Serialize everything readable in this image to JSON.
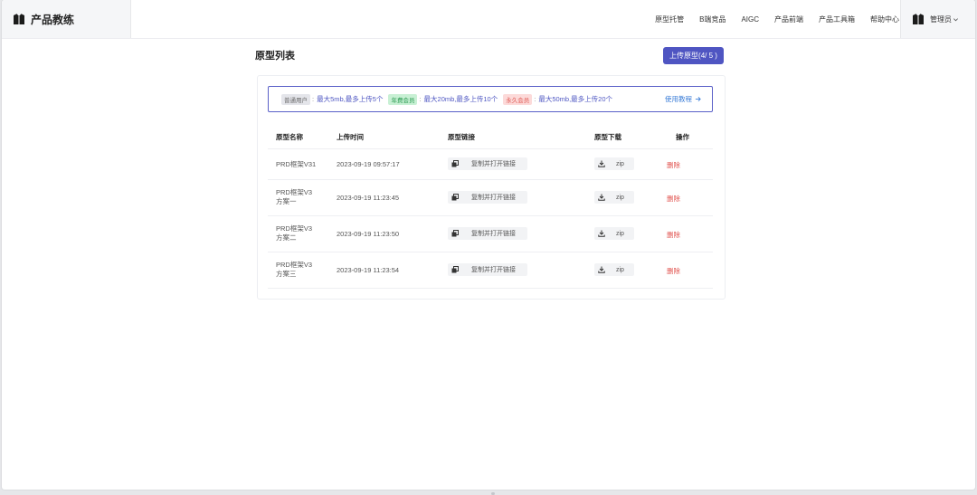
{
  "header": {
    "brand_name": "产品教练",
    "nav": [
      "原型托管",
      "B端竞品",
      "AIGC",
      "产品前端",
      "产品工具箱",
      "帮助中心"
    ],
    "user_name": "管理员"
  },
  "page": {
    "title": "原型列表",
    "upload_label": "上传原型(4/ 5 )"
  },
  "notice": {
    "tier1_tag": "普通用户",
    "tier1_quota": "最大5mb,最多上传5个",
    "tier2_tag": "年费会员",
    "tier2_quota": "最大20mb,最多上传10个",
    "tier3_tag": "永久会员",
    "tier3_quota": "最大50mb,最多上传20个",
    "separator": ":",
    "tutorial_label": "使用教程"
  },
  "table": {
    "headers": {
      "name": "原型名称",
      "time": "上传时间",
      "link": "原型链接",
      "download": "原型下载",
      "action": "操作"
    },
    "copy_label": "复制并打开链接",
    "download_label": "zip",
    "delete_label": "删除",
    "rows": [
      {
        "name_line1": "PRD框架V31",
        "name_line2": "",
        "time": "2023-09-19 09:57:17"
      },
      {
        "name_line1": "PRD框架V3",
        "name_line2": "方案一",
        "time": "2023-09-19 11:23:45"
      },
      {
        "name_line1": "PRD框架V3",
        "name_line2": "方案二",
        "time": "2023-09-19 11:23:50"
      },
      {
        "name_line1": "PRD框架V3",
        "name_line2": "方案三",
        "time": "2023-09-19 11:23:54"
      }
    ]
  },
  "colors": {
    "accent": "#4f55c2",
    "link": "#3c7ed8",
    "danger": "#e0504c"
  }
}
